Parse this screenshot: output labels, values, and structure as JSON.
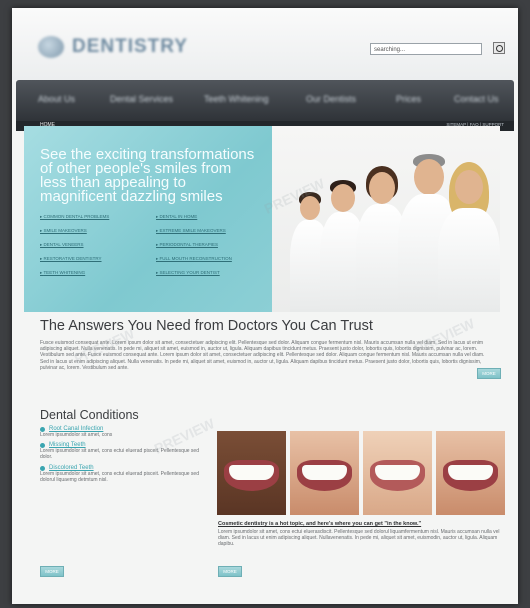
{
  "header": {
    "logo_text": "DENTISTRY",
    "search_placeholder": "searching..."
  },
  "nav": {
    "items": [
      "About Us",
      "Dental Services",
      "Teeth Whitening",
      "Our Dentists",
      "Prices",
      "Contact Us"
    ],
    "home": "HOME",
    "utility": "SITEMAP | FAQ | SUPPORT"
  },
  "hero": {
    "headline": "See the exciting transformations of other people's smiles from less than appealing to magnificent dazzling smiles",
    "links": [
      "COMMON DENTAL PROBLEMS",
      "DENTAL IN HOME",
      "SMILE MAKEOVERS",
      "EXTREME SMILE MAKEOVERS",
      "DENTAL VENEERS",
      "PERIODONTAL THERAPIES",
      "RESTORATIVE DENTISTRY",
      "FULL MOUTH RECONSTRUCTION",
      "TEETH WHITENING",
      "SELECTING YOUR DENTIST"
    ]
  },
  "intro": {
    "title": "The Answers You Need from Doctors You Can Trust",
    "body": "Fusce euismod consequat ante. Lorem ipsum dolor sit amet, consectetuer adipiscing elit. Pellentesque sed dolor. Aliquam congue fermentum nisl. Mauris accumsan nulla vel diam. Sed in lacus ut enim adipiscing aliquet. Nulla venenatis. In pede mi, aliquet sit amet, euismod in, auctor ut, ligula. Aliquam dapibus tincidunt metus. Praesent justo dolor, lobortis quis, lobortis dignissim, pulvinar ac, lorem. Vestibulum sed ante. Fusce euismod consequat ante. Lorem ipsum dolor sit amet, consectetuer adipiscing elit. Pellentesque sed dolor. Aliquam congue fermentum nisl. Mauris accumsan nulla vel diam. Sed in lacus ut enim adipiscing aliquet. Nulla venenatis. In pede mi, aliquet sit amet, euismod in, auctor ut, ligula. Aliquam dapibus tincidunt metus. Praesent justo dolor, lobortis quis, lobortis dignissim, pulvinar ac, lorem. Vestibulum sed ante.",
    "more": "MORE"
  },
  "conditions": {
    "title": "Dental Conditions",
    "items": [
      {
        "title": "Root Canal Infection",
        "text": "Lorem ipsumdolor sit amet, cons"
      },
      {
        "title": "Missing Teeth",
        "text": "Lorem ipsumdolor sit amet, cons ectui eluerad pisceit. Pellentesque sed dolor."
      },
      {
        "title": "Discolored Teeth",
        "text": "Lorem ipsumdolor sit amet, cons ectui eluerad pisceit. Pellentesque sed dolorul liquaemg detmtum nisl."
      }
    ],
    "more": "MORE"
  },
  "article": {
    "title": "Cosmetic dentistry is a hot topic, and here's where you can get \"in the know.\"",
    "body": "Lorem ipsumdolor sit amet, cons ectui eluerasdiscit. Pellentesque sed dolorul liquamfermentum nisl. Mauris accumsan nulla vel diam. Sed in lacus ut enim adipiscing aliquet. Nullavenenatis. In pede mi, aliquet sit amet, euismodin, auctor ut, ligula. Aliquam dapibu.",
    "more": "MORE"
  },
  "watermark_text": "PREVIEW"
}
